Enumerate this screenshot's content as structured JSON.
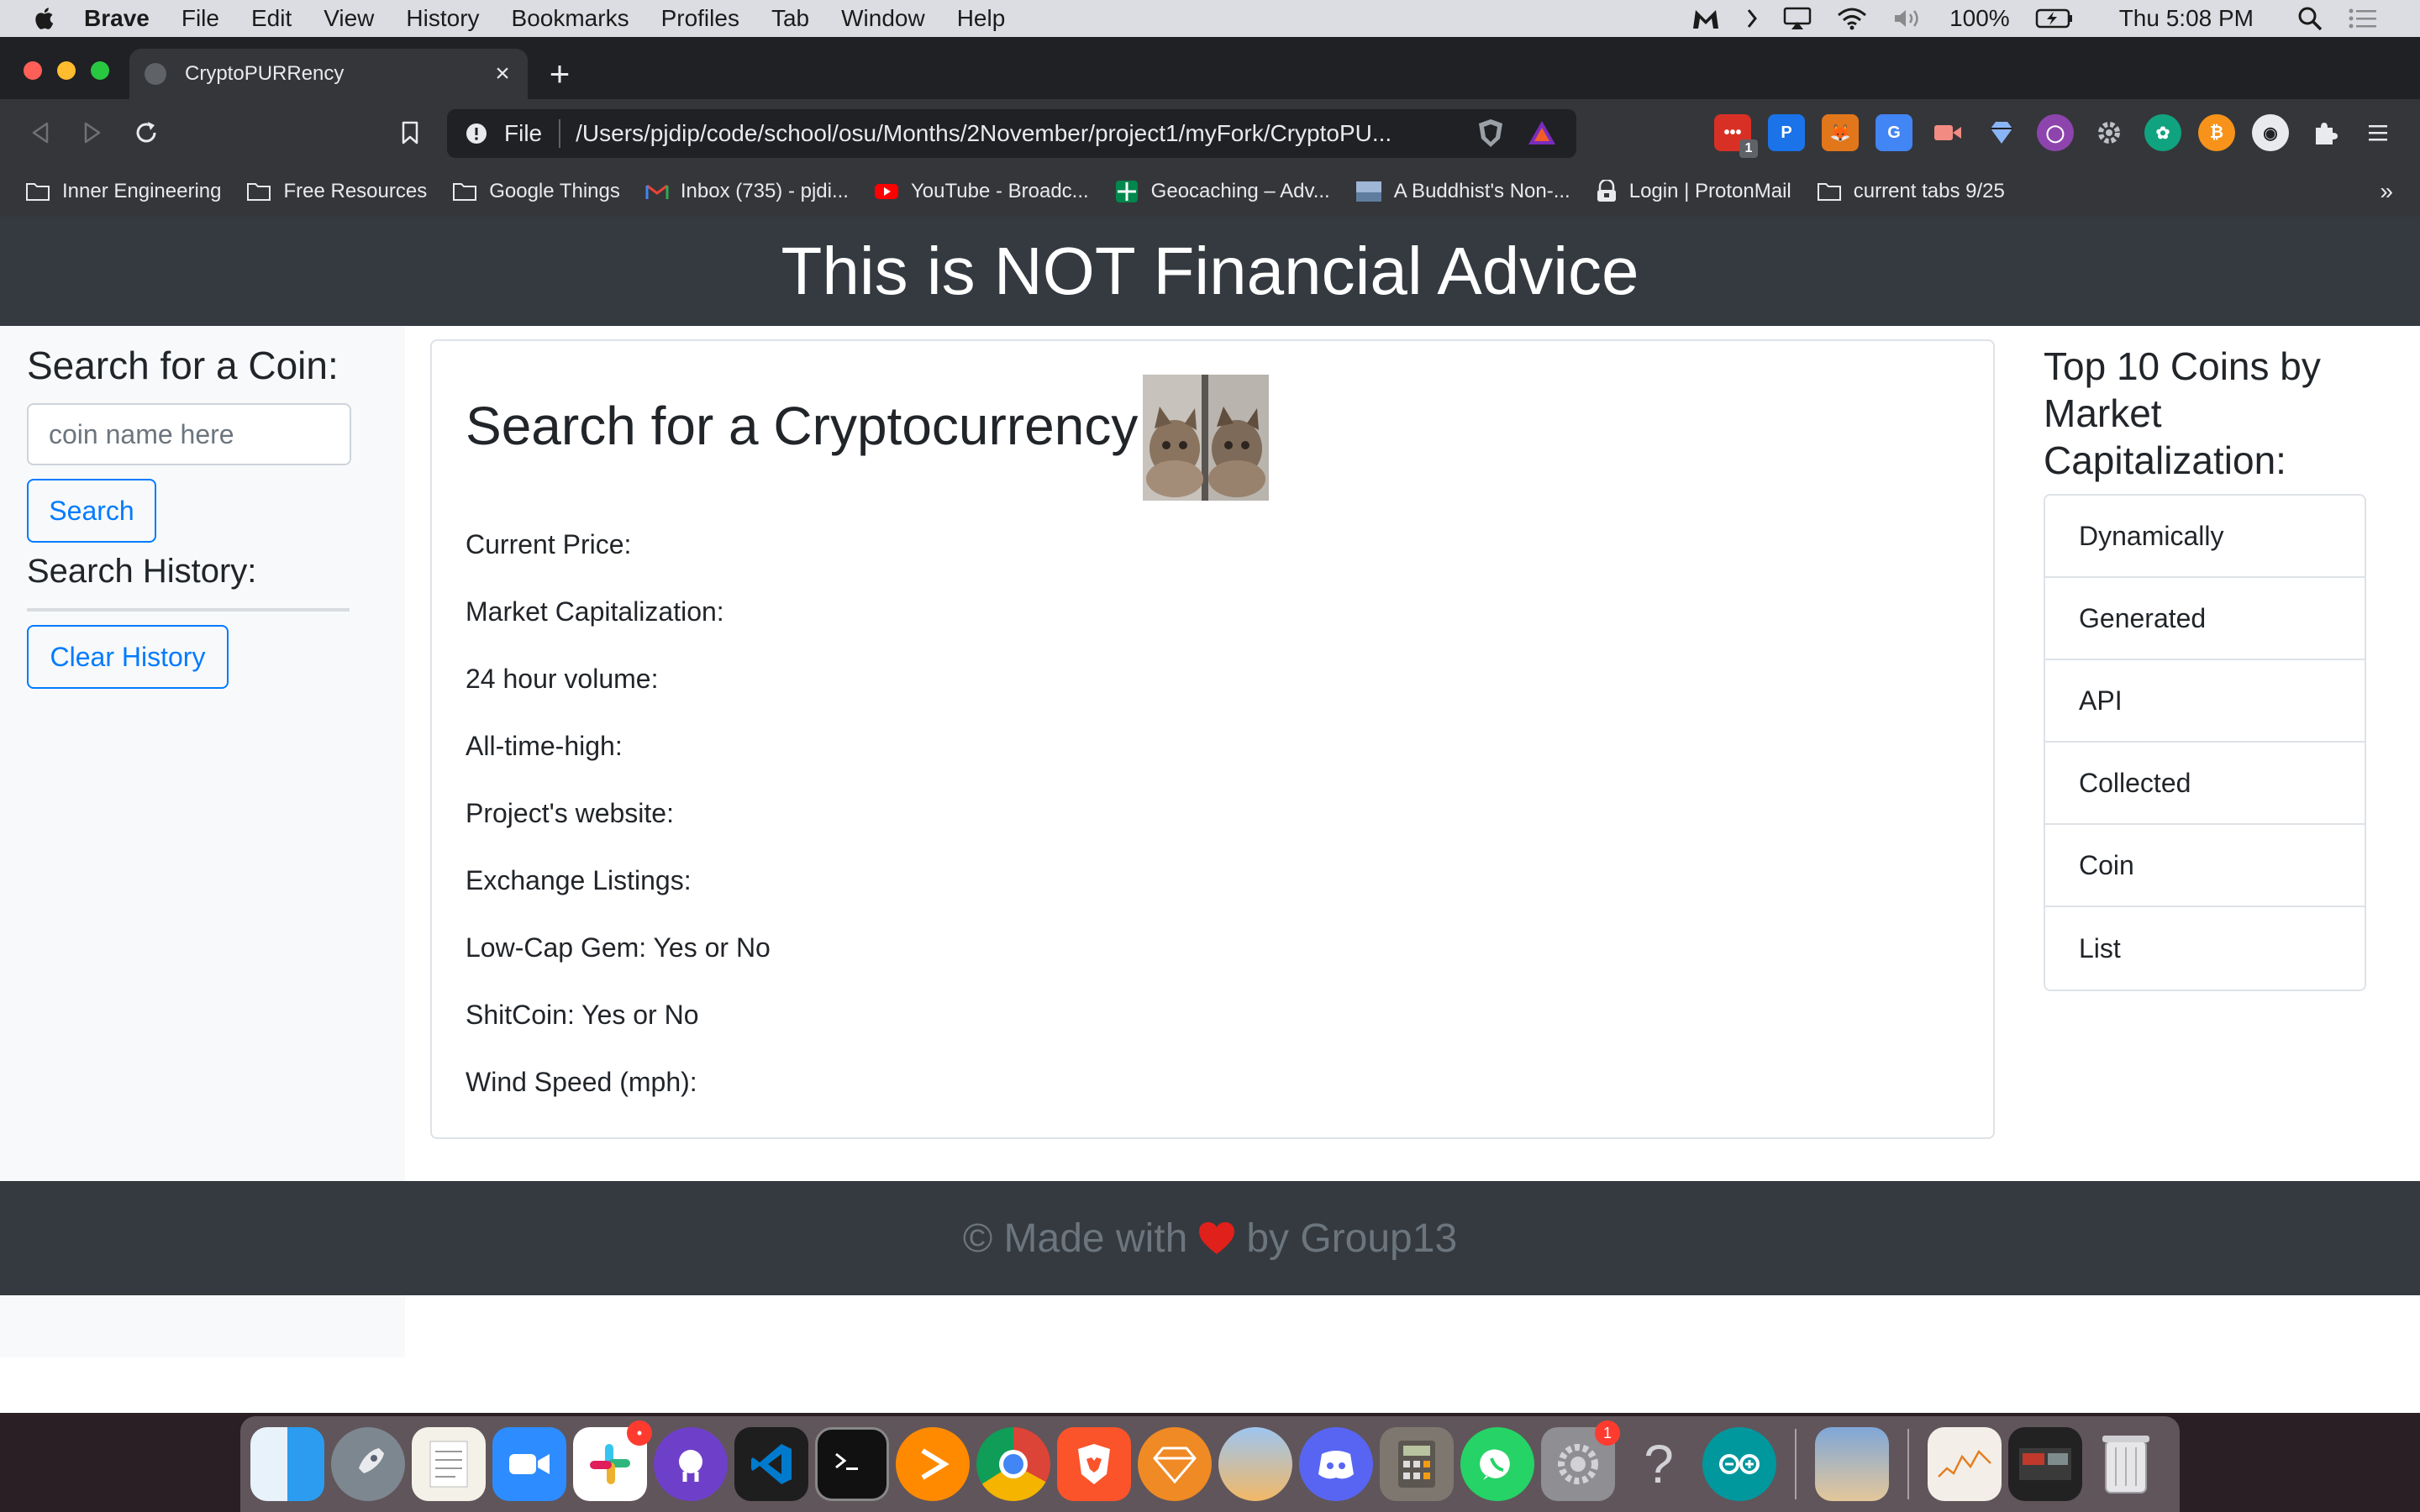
{
  "menubar": {
    "app_name": "Brave",
    "items": [
      "File",
      "Edit",
      "View",
      "History",
      "Bookmarks",
      "Profiles",
      "Tab",
      "Window",
      "Help"
    ],
    "battery": "100%",
    "clock": "Thu 5:08 PM"
  },
  "browser": {
    "tab_title": "CryptoPURRency",
    "tab_close": "×",
    "new_tab": "+",
    "url_scheme": "File",
    "url": "/Users/pjdip/code/school/osu/Months/2November/project1/myFork/CryptoPU...",
    "extension_badge": "1",
    "bookmarks": [
      {
        "label": "Inner Engineering",
        "icon": "folder-icon"
      },
      {
        "label": "Free Resources",
        "icon": "folder-icon"
      },
      {
        "label": "Google Things",
        "icon": "folder-icon"
      },
      {
        "label": "Inbox (735) - pjdi...",
        "icon": "gmail-icon"
      },
      {
        "label": "YouTube - Broadc...",
        "icon": "youtube-icon"
      },
      {
        "label": "Geocaching – Adv...",
        "icon": "geocaching-icon"
      },
      {
        "label": "A Buddhist's Non-...",
        "icon": "image-icon"
      },
      {
        "label": "Login | ProtonMail",
        "icon": "protonmail-icon"
      },
      {
        "label": "current tabs 9/25",
        "icon": "folder-icon"
      }
    ],
    "bookmarks_more": "»"
  },
  "site": {
    "header": "This is NOT Financial Advice",
    "sidebar": {
      "search_title": "Search for a Coin:",
      "search_placeholder": "coin name here",
      "search_button": "Search",
      "history_title": "Search History:",
      "clear_button": "Clear History"
    },
    "main": {
      "title": "Search for a Cryptocurrency",
      "fields": [
        "Current Price:",
        "Market Capitalization:",
        "24 hour volume:",
        "All-time-high:",
        "Project's website:",
        "Exchange Listings:",
        "Low-Cap Gem: Yes or No",
        "ShitCoin: Yes or No",
        "Wind Speed (mph):"
      ]
    },
    "top_coins": {
      "title": "Top 10 Coins by Market Capitalization:",
      "items": [
        "Dynamically",
        "Generated",
        "API",
        "Collected",
        "Coin",
        "List"
      ]
    },
    "footer": {
      "prefix": "© Made with",
      "suffix": "by Group13"
    }
  },
  "dock": {
    "slack_badge": "•",
    "prefs_badge": "1",
    "help_glyph": "?"
  },
  "colors": {
    "header_bg": "#343a40",
    "accent_blue": "#007bff",
    "sidebar_bg": "#f8f9fa",
    "heart": "#e0201b"
  }
}
